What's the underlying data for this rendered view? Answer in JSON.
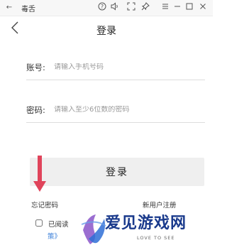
{
  "window": {
    "back_glyph": "←",
    "title": "毒舌",
    "help_glyph": "?",
    "volume_glyph": "◁",
    "fullscreen_glyph": "⛶",
    "pin_glyph": "⊿",
    "menu_glyph": "≡",
    "minimize_glyph": "—",
    "maximize_glyph": "☐",
    "close_glyph": "✕"
  },
  "header": {
    "title": "登录"
  },
  "form": {
    "account_label": "账号:",
    "account_placeholder": "请输入手机号码",
    "password_label": "密码:",
    "password_placeholder": "请输入至少6位数的密码",
    "login_label": "登录"
  },
  "links": {
    "forgot_password": "忘记密码",
    "register": "新用户注册"
  },
  "agreement": {
    "prefix": "已阅读",
    "policy": "策》"
  },
  "watermark": {
    "text": "爱见游戏网",
    "subtext": "LOVE TO SEE"
  },
  "colors": {
    "accent_arrow": "#e0445b",
    "link_blue": "#3a7fd9",
    "watermark_blue": "#1a3a8c",
    "button_bg": "#efefef"
  }
}
